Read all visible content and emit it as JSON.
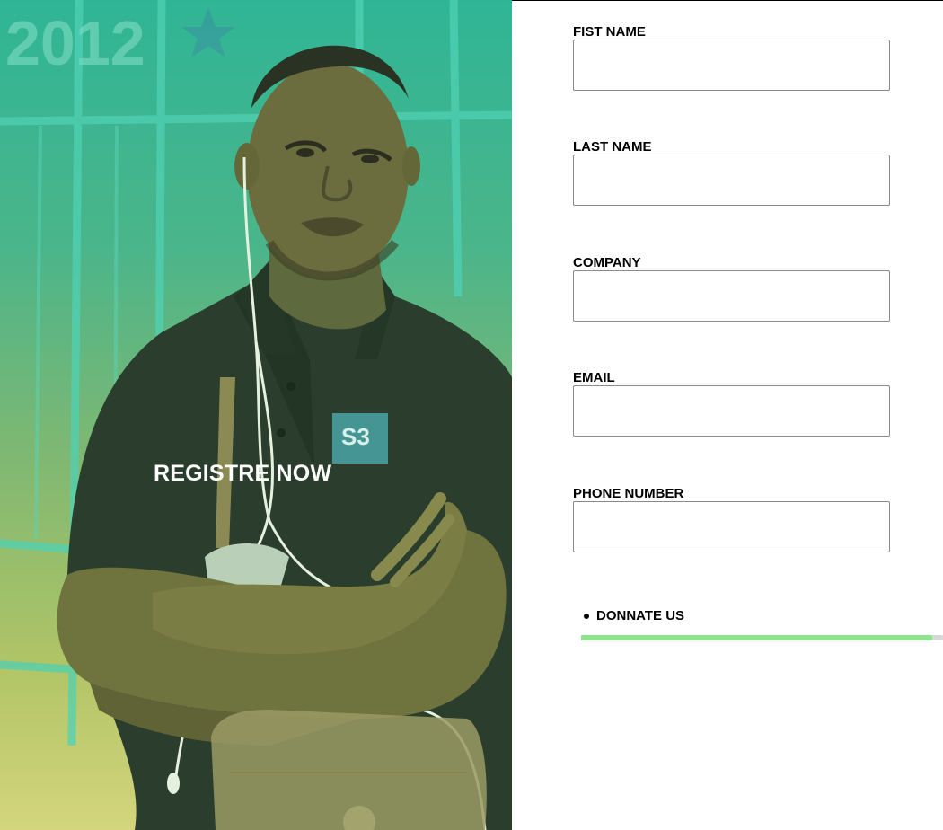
{
  "hero": {
    "title": "REGISTRE NOW",
    "wall_text": "2012",
    "shirt_logo": "S3",
    "gradient_top": "#2fb596",
    "gradient_bottom": "#d4d57c"
  },
  "form": {
    "fields": [
      {
        "label": "FIST NAME",
        "value": "",
        "placeholder": ""
      },
      {
        "label": "LAST NAME",
        "value": "",
        "placeholder": ""
      },
      {
        "label": "COMPANY",
        "value": "",
        "placeholder": ""
      },
      {
        "label": "EMAIL",
        "value": "",
        "placeholder": ""
      },
      {
        "label": "PHONE NUMBER",
        "value": "",
        "placeholder": ""
      }
    ]
  },
  "donate": {
    "label": "DONNATE US",
    "progress": 0.97,
    "fill_color": "#8ee38e"
  }
}
